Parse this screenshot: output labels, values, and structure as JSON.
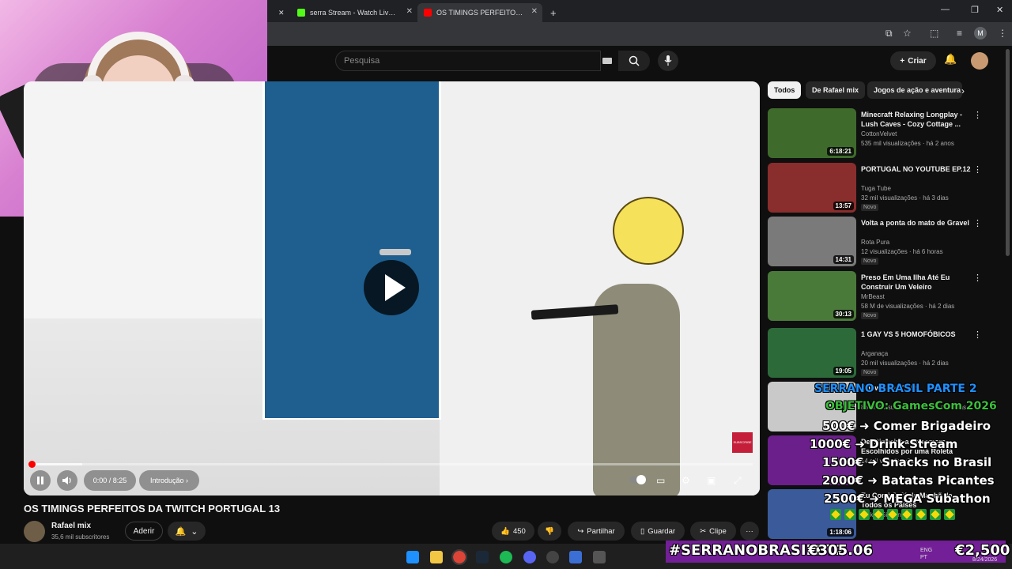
{
  "browser": {
    "tabs": [
      {
        "label": "serra Stream - Watch Live on Ki",
        "favicon_color": "#53fc18"
      },
      {
        "label": "OS TIMINGS PERFEITOS DA TWITCH PORTUGAL 13",
        "favicon_color": "#ff0000"
      }
    ],
    "new_tab": "+",
    "tab_close": "✕",
    "profile_initial": "M",
    "win_controls": {
      "minimize": "—",
      "maximize": "❐",
      "close": "✕"
    }
  },
  "youtube": {
    "search_placeholder": "Pesquisa",
    "create_label": "Criar",
    "player": {
      "time": "0:00 / 8:25",
      "chapter": "Introdução",
      "progress": 0.0,
      "buffer": 0.07,
      "subscribe_badge": "SUBSCRIBE"
    },
    "video_title": "OS TIMINGS PERFEITOS DA TWITCH PORTUGAL 13",
    "channel": {
      "name": "Rafael mix",
      "subs": "35,6 mil subscritores",
      "join": "Aderir"
    },
    "actions": {
      "likes": "450",
      "share": "Partilhar",
      "save": "Guardar",
      "clip": "Clipe",
      "more": "···"
    },
    "chips": [
      "Todos",
      "De Rafael mix",
      "Jogos de ação e aventura"
    ],
    "recommendations": [
      {
        "title": "Minecraft Relaxing Longplay - Lush Caves - Cozy Cottage ...",
        "channel": "CottonVelvet",
        "meta": "535 mil visualizações · há 2 anos",
        "duration": "6:18:21",
        "badge": "",
        "color": "#3e6b2c"
      },
      {
        "title": "PORTUGAL NO YOUTUBE EP.12",
        "channel": "Tuga Tube",
        "meta": "32 mil visualizações · há 3 dias",
        "duration": "13:57",
        "badge": "Novo",
        "color": "#8a2d2d"
      },
      {
        "title": "Volta a ponta do mato de Gravel",
        "channel": "Rota Pura",
        "meta": "12 visualizações · há 6 horas",
        "duration": "14:31",
        "badge": "Novo",
        "color": "#7a7a7a"
      },
      {
        "title": "Preso Em Uma Ilha Até Eu Construir Um Veleiro",
        "channel": "MrBeast",
        "meta": "58 M de visualizações · há 2 dias",
        "duration": "30:13",
        "badge": "Novo",
        "color": "#4a7a3a"
      },
      {
        "title": "1 GAY VS 5 HOMOFÓBICOS",
        "channel": "Arganaça",
        "meta": "20 mil visualizações · há 2 dias",
        "duration": "19:05",
        "badge": "Novo",
        "color": "#2d6a3a"
      },
      {
        "title": "Knowledge Quiz",
        "channel": "",
        "meta": "839 mil visualizações · há 2 semanas",
        "duration": "",
        "badge": "",
        "color": "#c9c9c9"
      },
      {
        "title": "Dei Dinheiro a Streamers Escolhidos por uma Roleta",
        "channel": "",
        "meta": "14 mil visualizações",
        "duration": "",
        "badge": "",
        "color": "#6a1f8a"
      },
      {
        "title": "Eu Comi Café da Manhã de Todos os Países",
        "channel": "Nick DiGiovanni",
        "meta": "",
        "duration": "1:18:06",
        "badge": "",
        "color": "#3a5a9a"
      }
    ]
  },
  "overlay": {
    "line1": "SERRANO BRASIL PARTE 2",
    "line2": "OBJETIVO: GamesCom 2026",
    "goals": [
      "500€ ➜ Comer Brigadeiro",
      "1000€ ➜ Drink Stream",
      "1500€ ➜ Snacks no Brasil",
      "2000€ ➜ Batatas Picantes",
      "2500€ ➜ MEGA Subathon"
    ],
    "hashtag": "#SERRANOBRASILPT2",
    "current": "€305.06",
    "goal": "€2,500"
  },
  "taskbar": {
    "lang": "ENG",
    "region": "PT",
    "date": "8/24/2026"
  },
  "colors": {
    "accent": "#ff0000",
    "banner": "#7b1fa2",
    "door": "#1e5f90"
  }
}
